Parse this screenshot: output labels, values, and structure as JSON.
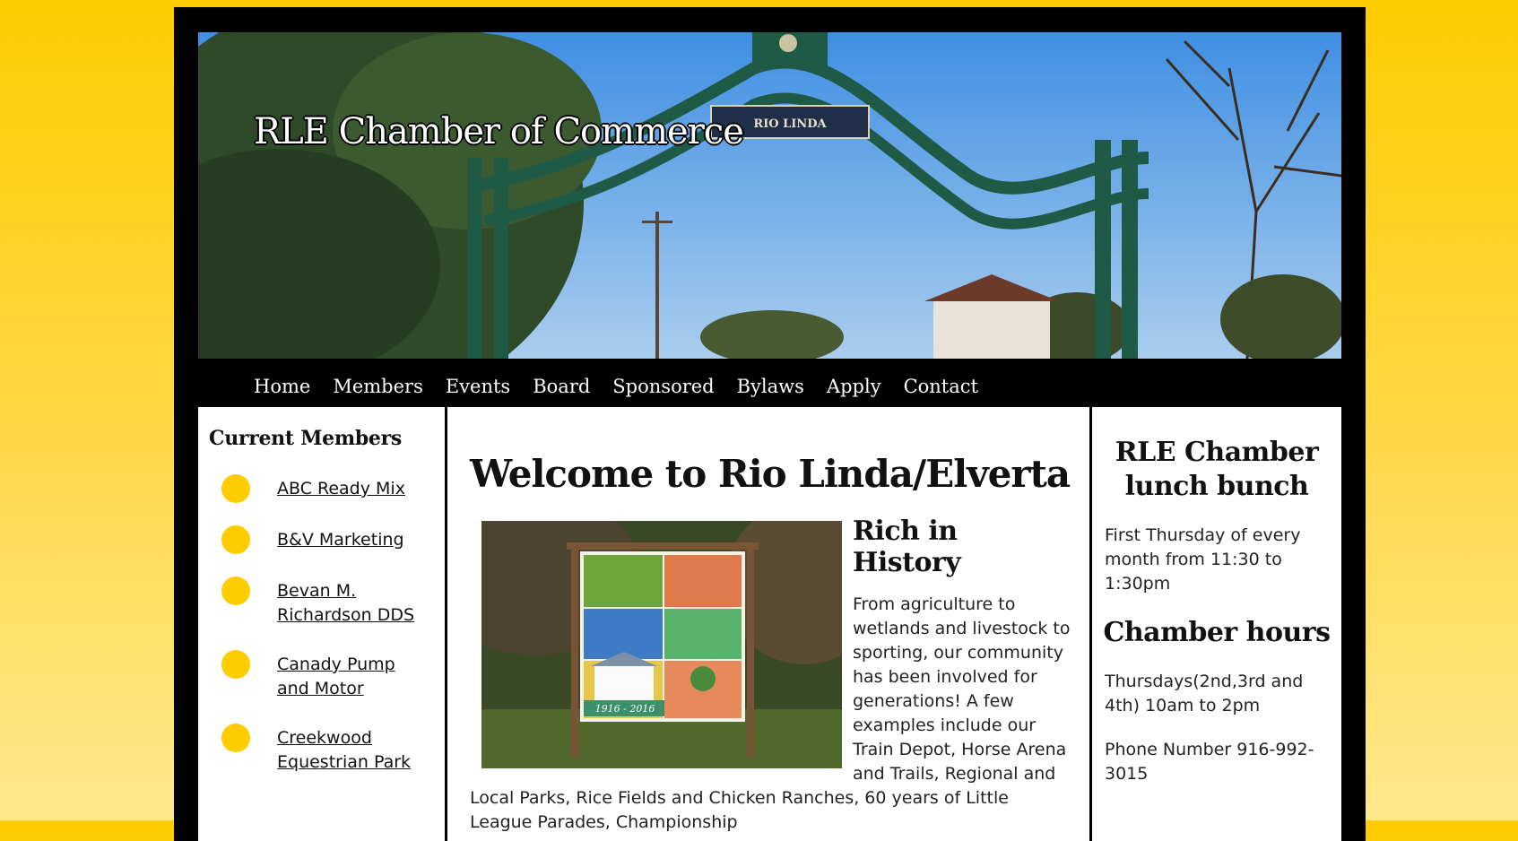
{
  "site": {
    "title": "RLE Chamber of Commerce"
  },
  "nav": {
    "items": [
      "Home",
      "Members",
      "Events",
      "Board",
      "Sponsored",
      "Bylaws",
      "Apply",
      "Contact"
    ]
  },
  "sidebar": {
    "heading": "Current Members",
    "members": [
      "ABC Ready Mix",
      "B&V Marketing",
      "Bevan M. Richardson DDS",
      "Canady Pump and Motor",
      "Creekwood Equestrian Park"
    ]
  },
  "main": {
    "heading": "Welcome to Rio Linda/Elverta",
    "subheading": "Rich in History",
    "body": "From agriculture to wetlands and livestock to sporting, our community has been involved for generations! A few examples include our Train Depot, Horse Arena and Trails, Regional and Local Parks, Rice Fields and Chicken Ranches, 60 years of Little League Parades, Championship",
    "quilt_caption": "1916 - 2016"
  },
  "aside": {
    "lunch_heading": "RLE Chamber lunch bunch",
    "lunch_text": "First Thursday of every month from 11:30 to 1:30pm",
    "hours_heading": "Chamber hours",
    "hours_text": "Thursdays(2nd,3rd and 4th) 10am to 2pm",
    "phone_text": "Phone Number 916-992-3015"
  },
  "hero": {
    "sign_text": "RIO LINDA"
  },
  "colors": {
    "accent": "#ffcc00",
    "frame": "#000000"
  }
}
